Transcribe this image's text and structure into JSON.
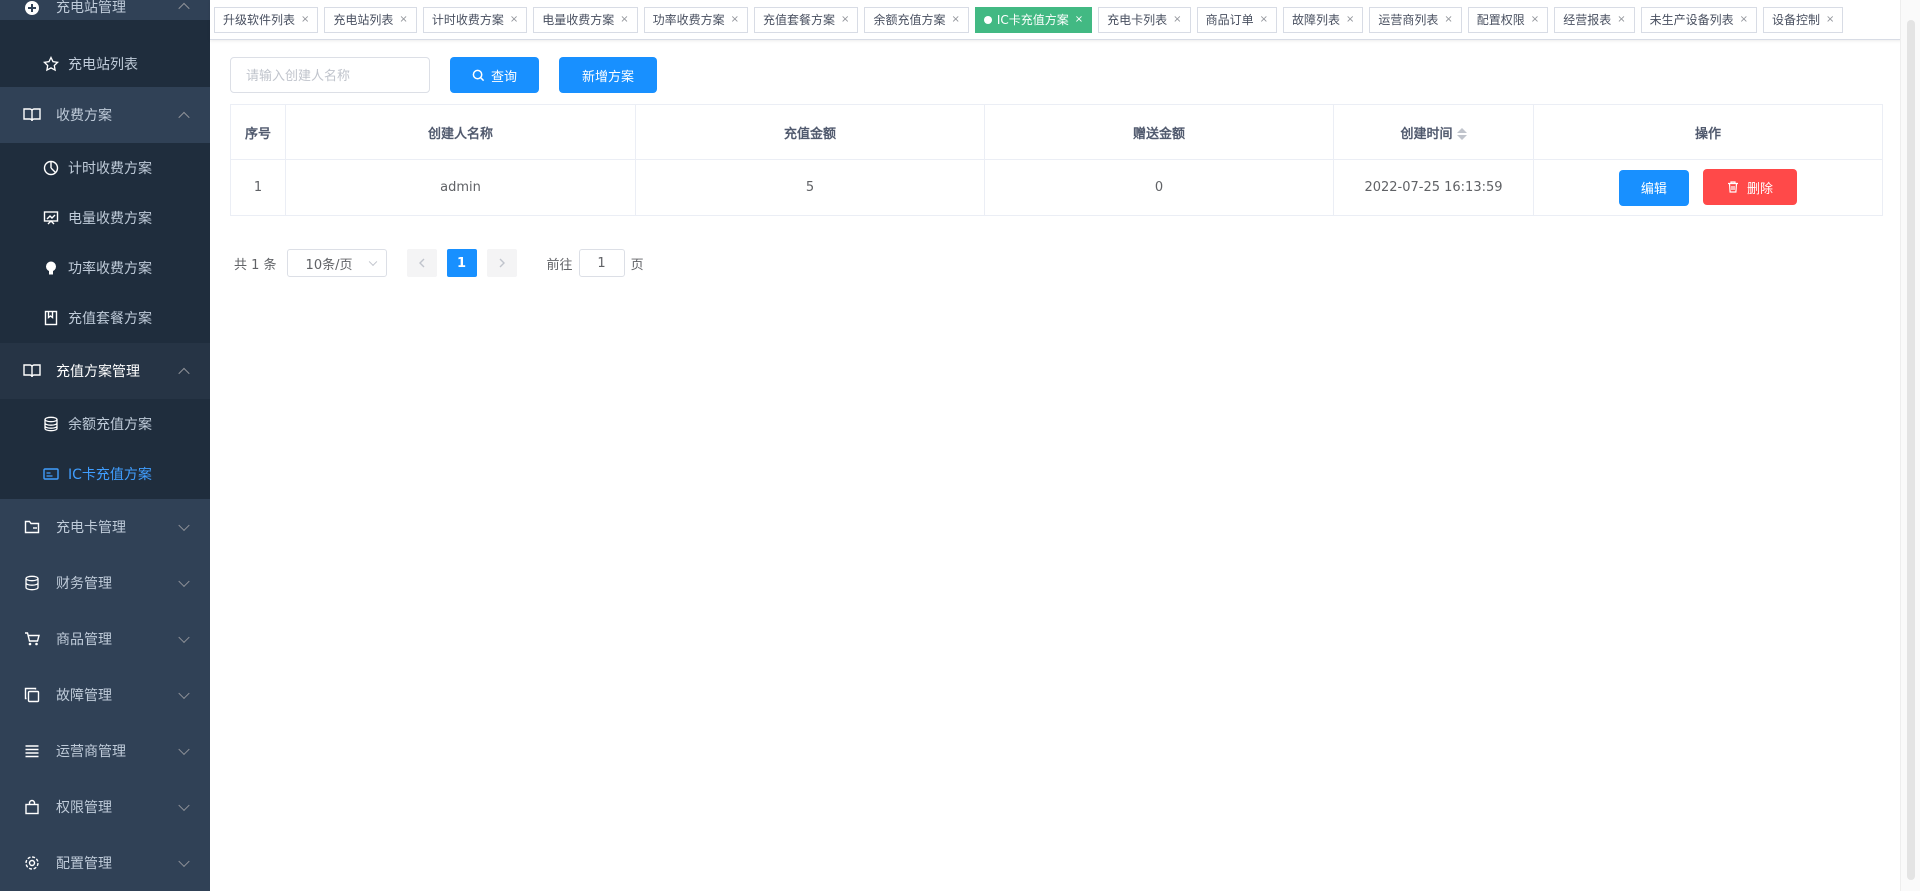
{
  "sidebar": {
    "top_title": "充电站管理",
    "items": [
      {
        "label": "充电站列表",
        "icon": "star-icon"
      },
      {
        "label": "收费方案",
        "icon": "book-icon"
      },
      {
        "label": "计时收费方案",
        "icon": "clock-icon"
      },
      {
        "label": "电量收费方案",
        "icon": "chart-icon"
      },
      {
        "label": "功率收费方案",
        "icon": "bulb-icon"
      },
      {
        "label": "充值套餐方案",
        "icon": "bookmark-icon"
      },
      {
        "label": "充值方案管理",
        "icon": "book-icon"
      },
      {
        "label": "余额充值方案",
        "icon": "coins-icon"
      },
      {
        "label": "IC卡充值方案",
        "icon": "card-icon"
      },
      {
        "label": "充电卡管理",
        "icon": "folder-icon"
      },
      {
        "label": "财务管理",
        "icon": "database-icon"
      },
      {
        "label": "商品管理",
        "icon": "cart-icon"
      },
      {
        "label": "故障管理",
        "icon": "copy-icon"
      },
      {
        "label": "运营商管理",
        "icon": "list-icon"
      },
      {
        "label": "权限管理",
        "icon": "bag-icon"
      },
      {
        "label": "配置管理",
        "icon": "gear-icon"
      }
    ],
    "accent_color": "#409eff"
  },
  "tags": [
    {
      "label": "升级软件列表"
    },
    {
      "label": "充电站列表"
    },
    {
      "label": "计时收费方案"
    },
    {
      "label": "电量收费方案"
    },
    {
      "label": "功率收费方案"
    },
    {
      "label": "充值套餐方案"
    },
    {
      "label": "余额充值方案"
    },
    {
      "label": "IC卡充值方案",
      "active": true
    },
    {
      "label": "充电卡列表"
    },
    {
      "label": "商品订单"
    },
    {
      "label": "故障列表"
    },
    {
      "label": "运营商列表"
    },
    {
      "label": "配置权限"
    },
    {
      "label": "经营报表"
    },
    {
      "label": "未生产设备列表"
    },
    {
      "label": "设备控制"
    }
  ],
  "toolbar": {
    "search_placeholder": "请输入创建人名称",
    "query_label": "查询",
    "add_label": "新增方案"
  },
  "table": {
    "headers": [
      "序号",
      "创建人名称",
      "充值金额",
      "赠送金额",
      "创建时间",
      "操作"
    ],
    "rows": [
      {
        "index": "1",
        "creator": "admin",
        "amount": "5",
        "bonus": "0",
        "created": "2022-07-25 16:13:59"
      }
    ],
    "edit_label": "编辑",
    "delete_label": "删除"
  },
  "pager": {
    "total": "共 1 条",
    "page_size": "10条/页",
    "current_page": "1",
    "goto_prefix": "前往",
    "goto_value": "1",
    "goto_suffix": "页"
  }
}
